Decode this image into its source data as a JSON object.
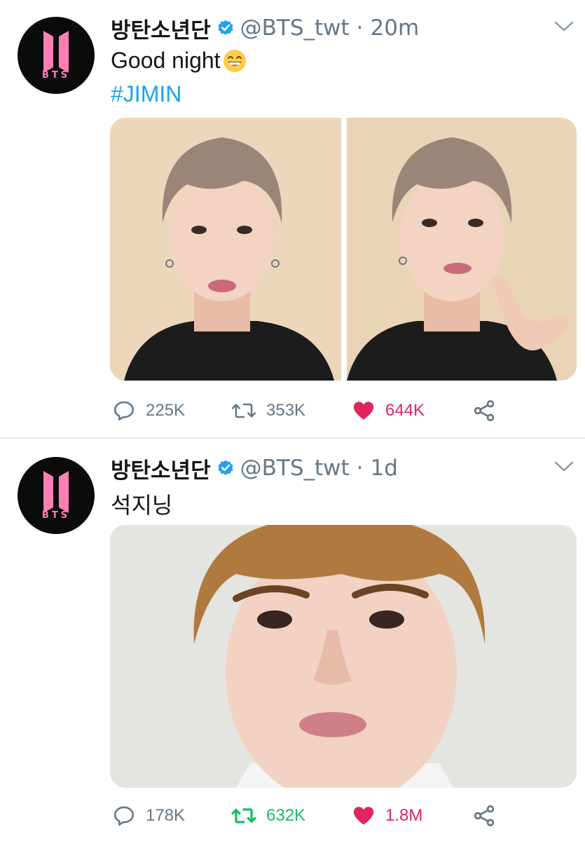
{
  "tweets": [
    {
      "avatar_text": "BTS",
      "name": "방탄소년단",
      "handle": "@BTS_twt",
      "separator": "·",
      "time": "20m",
      "text": "Good night",
      "emoji": "grinning-face-emoji",
      "hashtag": "#JIMIN",
      "media_count": 2,
      "replies": "225K",
      "retweets": "353K",
      "likes": "644K",
      "retweeted": false,
      "liked": true
    },
    {
      "avatar_text": "BTS",
      "name": "방탄소년단",
      "handle": "@BTS_twt",
      "separator": "·",
      "time": "1d",
      "text": "석지닝",
      "media_count": 1,
      "replies": "178K",
      "retweets": "632K",
      "likes": "1.8M",
      "retweeted": true,
      "liked": true
    }
  ],
  "colors": {
    "link": "#1da1f2",
    "secondary_text": "#657786",
    "like": "#e0245e",
    "retweet": "#17bf63",
    "verified": "#1da1f2",
    "divider": "#e6ecf0"
  }
}
